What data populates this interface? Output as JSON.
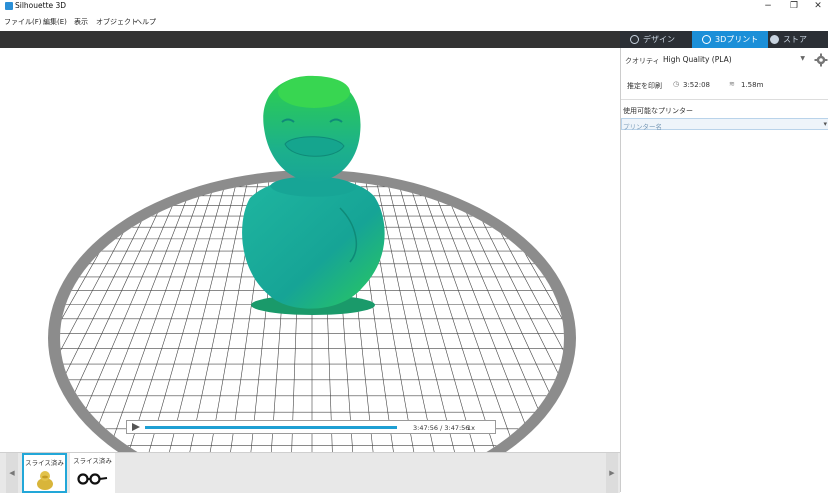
{
  "window": {
    "title": "Silhouette 3D",
    "minimize": "−",
    "restore": "❐",
    "close": "✕"
  },
  "menu": [
    "ファイル(F)",
    "編集(E)",
    "表示",
    "オブジェクト",
    "ヘルプ"
  ],
  "tabs": [
    {
      "label": "デザイン",
      "active": false,
      "icon": "globe-icon"
    },
    {
      "label": "3Dプリント",
      "active": true,
      "icon": "print-icon"
    },
    {
      "label": "ストア",
      "active": false,
      "icon": "store-icon"
    }
  ],
  "panel": {
    "quality_label": "クオリティ",
    "quality_value": "High Quality (PLA)",
    "estimate_label": "推定を印刷",
    "estimate_time": "3:52:08",
    "estimate_length": "1.58m",
    "printers_label": "使用可能なプリンター",
    "printer_name_header": "プリンター名"
  },
  "playback": {
    "time": "3:47:56 / 3:47:56",
    "speed": "1x",
    "progress": 1.0
  },
  "tray": {
    "items": [
      {
        "label": "スライス済み",
        "icon": "duck-thumbnail-icon",
        "selected": true
      },
      {
        "label": "スライス済み",
        "icon": "glasses-thumbnail-icon",
        "selected": false
      }
    ]
  },
  "colors": {
    "accent": "#1b8fd8",
    "model_teal": "#1aa89a",
    "model_green": "#2ed14a",
    "platform_ring": "#8c8c8c"
  }
}
